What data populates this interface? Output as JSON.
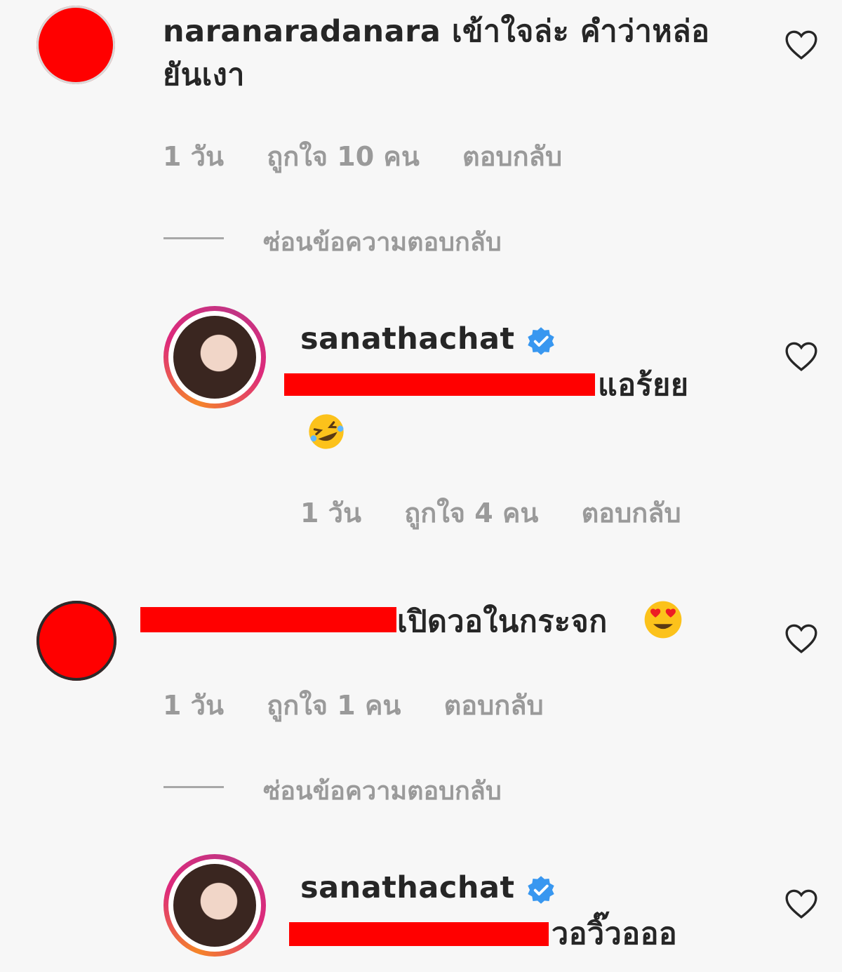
{
  "comments": [
    {
      "username": "naranaradanara",
      "text": "เข้าใจล่ะ คำว่าหล่อ",
      "text_cont": "ยันเงา",
      "time": "1 วัน",
      "likes": "ถูกใจ 10 คน",
      "reply": "ตอบกลับ",
      "hide_replies": "ซ่อนข้อความตอบกลับ",
      "replies": [
        {
          "username": "sanathachat",
          "text_suffix": "แอร้ยย",
          "emoji": "rolling-on-floor-laughing",
          "time": "1 วัน",
          "likes": "ถูกใจ 4 คน",
          "reply": "ตอบกลับ"
        }
      ]
    },
    {
      "text_suffix": "เปิดวอในกระจก",
      "emoji": "heart-eyes",
      "time": "1 วัน",
      "likes": "ถูกใจ 1 คน",
      "reply": "ตอบกลับ",
      "hide_replies": "ซ่อนข้อความตอบกลับ",
      "replies": [
        {
          "username": "sanathachat",
          "text_suffix": "วอวิ๊วอออ"
        }
      ]
    }
  ],
  "colors": {
    "redaction": "#ff0000",
    "verified": "#3897f0",
    "meta": "#9a9a9a",
    "heart_outline": "#262626"
  }
}
